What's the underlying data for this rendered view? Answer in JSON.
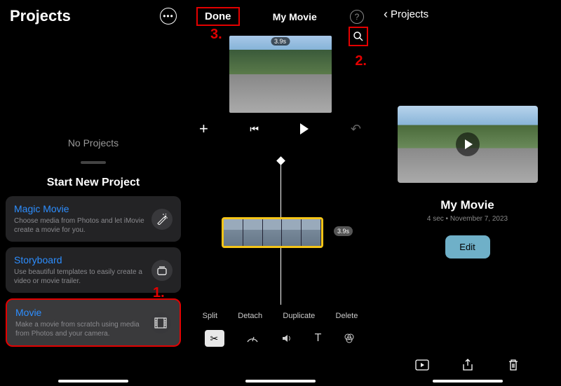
{
  "panel1": {
    "title": "Projects",
    "noProjects": "No Projects",
    "startNew": "Start New Project",
    "cards": [
      {
        "title": "Magic Movie",
        "desc": "Choose media from Photos and let iMovie create a movie for you.",
        "icon": "wand"
      },
      {
        "title": "Storyboard",
        "desc": "Use beautiful templates to easily create a video or movie trailer.",
        "icon": "stack"
      },
      {
        "title": "Movie",
        "desc": "Make a movie from scratch using media from Photos and your camera.",
        "icon": "film"
      }
    ],
    "annotations": {
      "n1": "1."
    }
  },
  "panel2": {
    "done": "Done",
    "title": "My Movie",
    "duration": "3.9s",
    "clipDuration": "3.9s",
    "editActions": [
      "Split",
      "Detach",
      "Duplicate",
      "Delete"
    ],
    "annotations": {
      "n2": "2.",
      "n3": "3."
    }
  },
  "panel3": {
    "back": "Projects",
    "projectTitle": "My Movie",
    "meta": "4 sec • November 7, 2023",
    "edit": "Edit"
  }
}
